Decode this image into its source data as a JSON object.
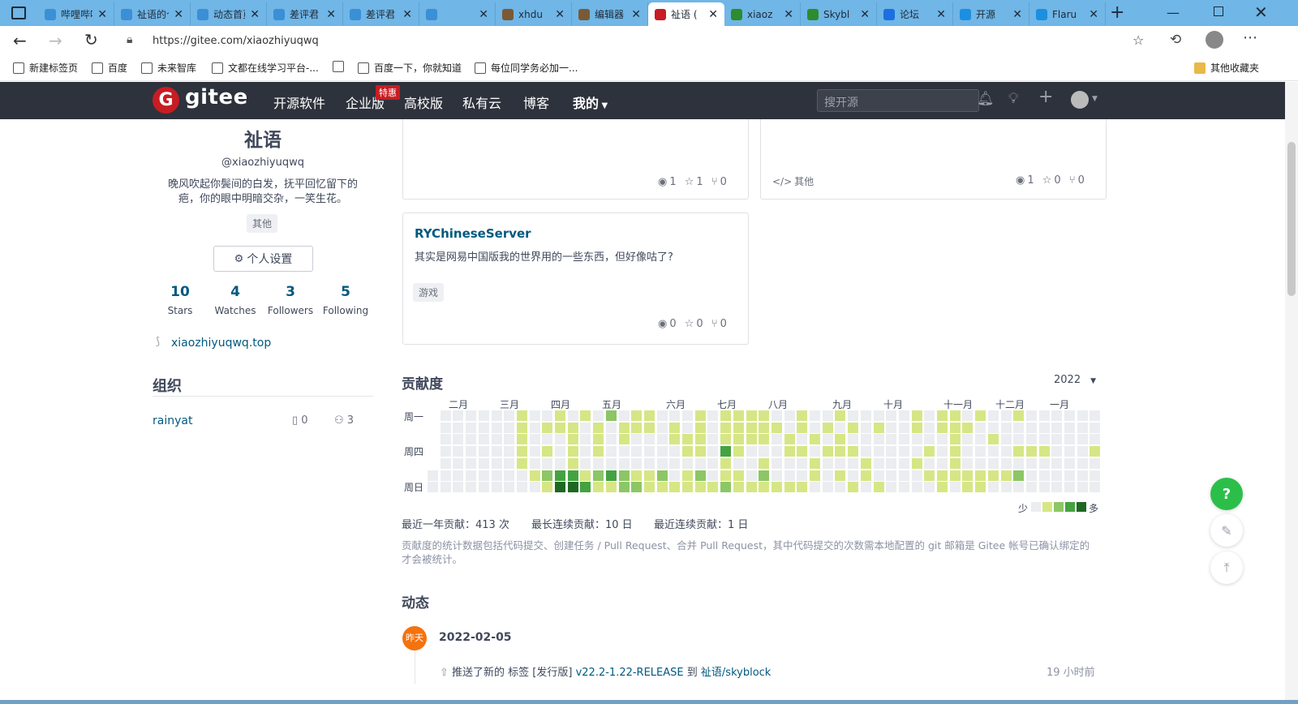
{
  "browser": {
    "tabs": [
      {
        "title": "哔哩哔哩",
        "favicon": "bilibili-tv-icon",
        "color": "#3a8fd6"
      },
      {
        "title": "祉语的个人空间",
        "favicon": "bilibili-tv-icon",
        "color": "#3a8fd6"
      },
      {
        "title": "动态首页",
        "favicon": "bilibili-tv-icon",
        "color": "#3a8fd6"
      },
      {
        "title": "差评君",
        "favicon": "bilibili-tv-icon",
        "color": "#3a8fd6"
      },
      {
        "title": "差评君",
        "favicon": "bilibili-tv-icon",
        "color": "#3a8fd6"
      },
      {
        "title": "",
        "favicon": "bilibili-tv-icon",
        "color": "#3a8fd6"
      },
      {
        "title": "xhdu",
        "favicon": "minecraft-block-icon",
        "color": "#7a5a34"
      },
      {
        "title": "编辑器",
        "favicon": "minecraft-block-icon",
        "color": "#7a5a34"
      },
      {
        "title": "祉语 (",
        "favicon": "gitee-logo-icon",
        "color": "#c71d23"
      },
      {
        "title": "xiaoz",
        "favicon": "creeper-icon",
        "color": "#2e8b2e"
      },
      {
        "title": "Skybl",
        "favicon": "creeper-icon",
        "color": "#2e8b2e"
      },
      {
        "title": "论坛",
        "favicon": "forum-icon",
        "color": "#1c6fe0"
      },
      {
        "title": "开源",
        "favicon": "cloud-icon",
        "color": "#1c8fe0"
      },
      {
        "title": "Flaru",
        "favicon": "cloud-icon",
        "color": "#1c8fe0"
      }
    ],
    "url": "https://gitee.com/xiaozhiyuqwq",
    "bookmarks": [
      "新建标签页",
      "百度",
      "未来智库",
      "文都在线学习平台-...",
      "",
      "百度一下，你就知道",
      "每位同学务必加一..."
    ],
    "other_bookmarks": "其他收藏夹"
  },
  "gitee": {
    "logo_text": "gitee",
    "nav": [
      "开源软件",
      "企业版",
      "高校版",
      "私有云",
      "博客",
      "我的"
    ],
    "enterprise_badge": "特惠",
    "search_placeholder": "搜开源",
    "accent": "#c71d23",
    "header_bg": "#2e323c"
  },
  "profile": {
    "name": "祉语",
    "handle": "@xiaozhiyuqwq",
    "bio": "晚风吹起你鬓间的白发，抚平回忆留下的疤，你的眼中明暗交杂，一笑生花。",
    "tag": "其他",
    "settings_button": "个人设置",
    "stats": [
      {
        "value": "10",
        "label": "Stars"
      },
      {
        "value": "4",
        "label": "Watches"
      },
      {
        "value": "3",
        "label": "Followers"
      },
      {
        "value": "5",
        "label": "Following"
      }
    ],
    "website": "xiaozhiyuqwq.top"
  },
  "orgs": {
    "heading": "组织",
    "items": [
      {
        "name": "rainyat",
        "repos": "0",
        "members": "3"
      }
    ]
  },
  "repos": [
    {
      "name": "",
      "desc": "",
      "tag": "",
      "watch": "1",
      "star": "1",
      "fork": "0"
    },
    {
      "name": "",
      "desc": "",
      "lang": "其他",
      "watch": "1",
      "star": "0",
      "fork": "0"
    },
    {
      "name": "RYChineseServer",
      "desc": "其实是网易中国版我的世界用的一些东西，但好像咕了?",
      "tag": "游戏",
      "watch": "0",
      "star": "0",
      "fork": "0"
    }
  ],
  "contrib": {
    "heading": "贡献度",
    "year": "2022",
    "months": [
      "二月",
      "三月",
      "四月",
      "五月",
      "六月",
      "七月",
      "八月",
      "九月",
      "十月",
      "十一月",
      "十二月",
      "一月"
    ],
    "day_labels": [
      "周一",
      "周四",
      "周日"
    ],
    "legend_less": "少",
    "legend_more": "多",
    "summary": [
      "最近一年贡献：413 次",
      "最长连续贡献：10 日",
      "最近连续贡献：1 日"
    ],
    "note": "贡献度的统计数据包括代码提交、创建任务 / Pull Request、合并 Pull Request，其中代码提交的次数需本地配置的 git 邮箱是 Gitee 帐号已确认绑定的才会被统计。",
    "colors": [
      "#ebedf0",
      "#d6e685",
      "#8cc665",
      "#44a340",
      "#1e6823"
    ],
    "weeks": 53,
    "levels_by_row": [
      "0000000010010102011000101111001001000001011010010000000000000000000000000000",
      "0000000010111010111010101111101010101001011100000000000000000000000000000000",
      "0000000010001010100011101111010101000000001001000000000000000000000000000000",
      "0000000010101010000001103100011011100000101000011100011110111010000000000000",
      "0000000010001000000000001001000100010001001000000000000000000000000000000000",
      "0000000001233123211201201102000101010000111111120000000000000000000000000000",
      "0000000000144311221111112111111000101000010110000000000000000000000000000000"
    ]
  },
  "feed": {
    "heading": "动态",
    "badge": "昨天",
    "date": "2022-02-05",
    "item_prefix": "推送了新的 标签 [发行版]",
    "item_tag": "v22.2-1.22-RELEASE",
    "item_to": "到",
    "item_repo": "祉语/skyblock",
    "item_time": "19 小时前"
  },
  "fabs": {
    "help": "?"
  }
}
